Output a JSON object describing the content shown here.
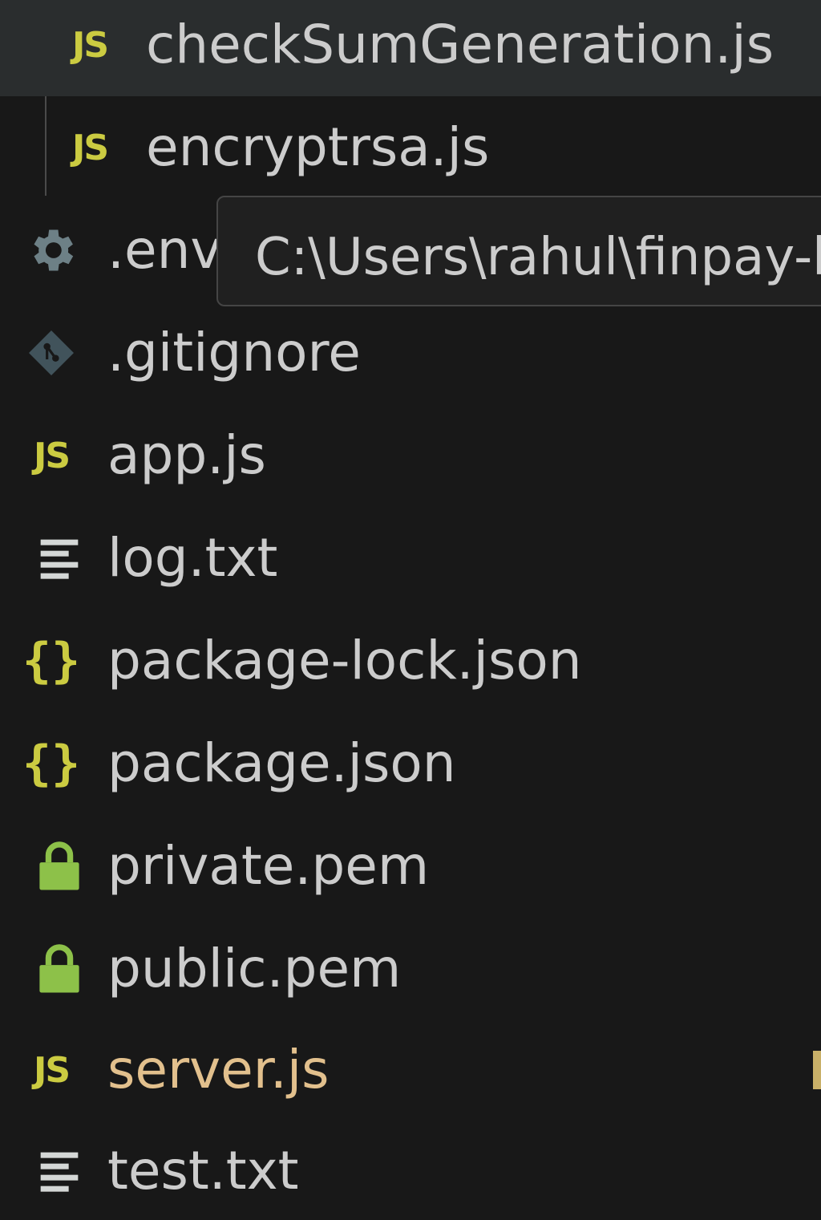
{
  "explorer": {
    "nested_files": [
      {
        "name": "checkSumGeneration.js",
        "icon": "js-icon",
        "hover": true
      },
      {
        "name": "encryptrsa.js",
        "icon": "js-icon"
      }
    ],
    "files": [
      {
        "name": ".env",
        "icon": "gear-icon"
      },
      {
        "name": ".gitignore",
        "icon": "git-icon"
      },
      {
        "name": "app.js",
        "icon": "js-icon"
      },
      {
        "name": "log.txt",
        "icon": "text-file-icon"
      },
      {
        "name": "package-lock.json",
        "icon": "json-icon"
      },
      {
        "name": "package.json",
        "icon": "json-icon"
      },
      {
        "name": "private.pem",
        "icon": "lock-icon"
      },
      {
        "name": "public.pem",
        "icon": "lock-icon"
      },
      {
        "name": "server.js",
        "icon": "js-icon",
        "modified": true
      },
      {
        "name": "test.txt",
        "icon": "text-file-icon"
      }
    ],
    "tooltip": "C:\\Users\\rahul\\finpay-b",
    "js_icon_text": "JS",
    "json_icon_text": "{}",
    "colors": {
      "background": "#181818",
      "hover": "#2a2d2e",
      "text": "#cccccc",
      "js_yellow": "#cbcb41",
      "lock_green": "#8dc149",
      "gear_blue": "#6d8086",
      "modified": "#e2c08d"
    }
  }
}
